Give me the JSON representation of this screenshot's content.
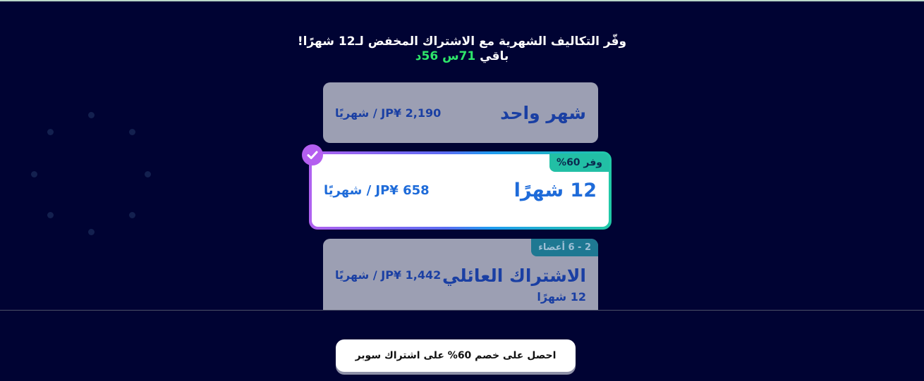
{
  "header": {
    "title": "وفّر التكاليف الشهرية مع الاشتراك المخفض لـ12 شهرًا!",
    "timer_prefix": "باقي ",
    "timer_value": "71س 56د"
  },
  "plans": {
    "monthly": {
      "name": "شهر واحد",
      "price": "JP¥ 2,190 / شهريًا"
    },
    "annual": {
      "name": "12 شهرًا",
      "price": "JP¥ 658 / شهريًا",
      "badge": "وفر 60%",
      "selected": true
    },
    "family": {
      "name": "الاشتراك العائلي",
      "sub": "12 شهرًا",
      "price": "JP¥ 1,442 / شهريًا",
      "badge": "2 - 6 أعضاء"
    }
  },
  "cta": {
    "label": "احصل على خصم 60% على اشتراك سوبر"
  },
  "icons": {
    "check": "check-icon",
    "spinner": "loading-spinner-icon"
  },
  "colors": {
    "background": "#000333",
    "accent_green": "#2ee66a",
    "selected_border": "#b45ff0",
    "save_badge": "#22bfa5"
  }
}
